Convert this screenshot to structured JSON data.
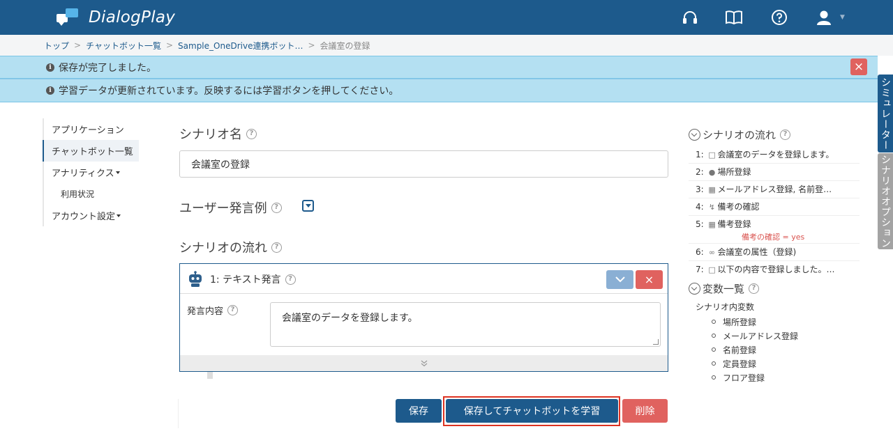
{
  "header": {
    "app_name": "DialogPlay"
  },
  "breadcrumb": {
    "items": [
      "トップ",
      "チャットボット一覧",
      "Sample_OneDrive連携ボット…"
    ],
    "current": "会議室の登録"
  },
  "alerts": {
    "saved": "保存が完了しました。",
    "learning": "学習データが更新されています。反映するには学習ボタンを押してください。"
  },
  "side_tabs": {
    "simulator": "シミュレーター",
    "scenario_option": "シナリオオプション"
  },
  "nav": {
    "application": "アプリケーション",
    "chatbot_list": "チャットボット一覧",
    "analytics": "アナリティクス",
    "usage": "利用状況",
    "account": "アカウント設定"
  },
  "main": {
    "scenario_name_label": "シナリオ名",
    "scenario_name_value": "会議室の登録",
    "user_examples_label": "ユーザー発言例",
    "flow_label": "シナリオの流れ",
    "card": {
      "title": "1: テキスト発言",
      "content_label": "発言内容",
      "content_value": "会議室のデータを登録します。"
    }
  },
  "buttons": {
    "save": "保存",
    "save_and_train": "保存してチャットボットを学習",
    "delete": "削除"
  },
  "right_panel": {
    "flow_title": "シナリオの流れ",
    "flow_items": [
      {
        "num": "1:",
        "icon": "speech-bubble-icon",
        "text": "会議室のデータを登録します。"
      },
      {
        "num": "2:",
        "icon": "location-icon",
        "text": "場所登録"
      },
      {
        "num": "3:",
        "icon": "form-icon",
        "text": "メールアドレス登録, 名前登…"
      },
      {
        "num": "4:",
        "icon": "branch-icon",
        "text": "備考の確認"
      },
      {
        "num": "5:",
        "icon": "form-icon",
        "text": "備考登録",
        "condition": "備考の確認 = yes"
      },
      {
        "num": "6:",
        "icon": "link-icon",
        "text": "会議室の属性（登録)"
      },
      {
        "num": "7:",
        "icon": "speech-bubble-icon",
        "text": "以下の内容で登録しました。…"
      }
    ],
    "vars_title": "変数一覧",
    "vars_scope": "シナリオ内変数",
    "vars": [
      "場所登録",
      "メールアドレス登録",
      "名前登録",
      "定員登録",
      "フロア登録"
    ]
  }
}
